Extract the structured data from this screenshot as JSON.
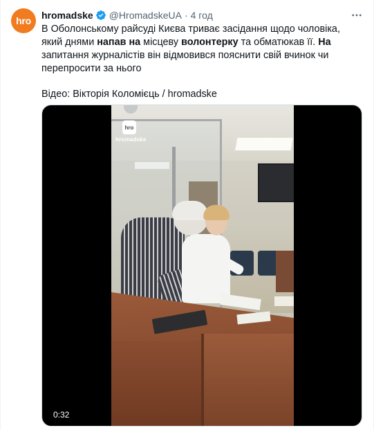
{
  "tweet": {
    "author": {
      "display_name": "hromadske",
      "handle": "@HromadskeUA",
      "verified": true,
      "avatar_text": "hro",
      "avatar_color": "#f07c1f"
    },
    "time": "4 год",
    "separator": "·",
    "more_icon": "more-horizontal-icon",
    "text": {
      "line1_part1": "В Оболонському райсуді Києва триває засідання щодо чоловіка, який днями ",
      "bold1": "напав на",
      "line1_part2": " місцеву ",
      "bold2": "волонтерку",
      "line1_part3": " та обматюкав її. ",
      "bold3": "На",
      "line1_part4": " запитання журналістів він відмовився пояснити свій вчинок чи перепросити за нього",
      "credit": "Відео: Вікторія Коломієць / hromadske"
    },
    "media": {
      "type": "video",
      "duration": "0:32",
      "watermark_logo": "hro",
      "watermark_label": "hromadske"
    }
  },
  "colors": {
    "verified_badge": "#1d9bf0",
    "secondary_text": "#536471",
    "primary_text": "#0f1419"
  }
}
